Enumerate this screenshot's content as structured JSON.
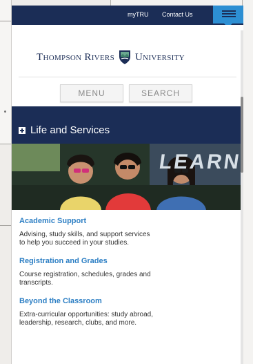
{
  "top_bar": {
    "links": [
      "myTRU",
      "Contact Us"
    ]
  },
  "header": {
    "logo_left": "Thompson Rivers",
    "logo_right": "University",
    "nav_menu": "MENU",
    "nav_search": "SEARCH"
  },
  "section": {
    "title": "Life and Services",
    "hero_text": "LEARN"
  },
  "items": [
    {
      "title": "Academic Support",
      "desc": "Advising, study skills, and support services to help you succeed in your studies."
    },
    {
      "title": "Registration and Grades",
      "desc": "Course registration, schedules, grades and transcripts."
    },
    {
      "title": "Beyond the Classroom",
      "desc": "Extra-curricular opportunities: study abroad, leadership, research, clubs, and more."
    }
  ],
  "colors": {
    "navy": "#1b2d56",
    "accent_blue": "#2d8fd3",
    "link_blue": "#2d7fc4"
  },
  "icons": {
    "menu_toggle": "hamburger-icon",
    "section_toggle": "plus-icon",
    "logo": "shield-icon"
  }
}
